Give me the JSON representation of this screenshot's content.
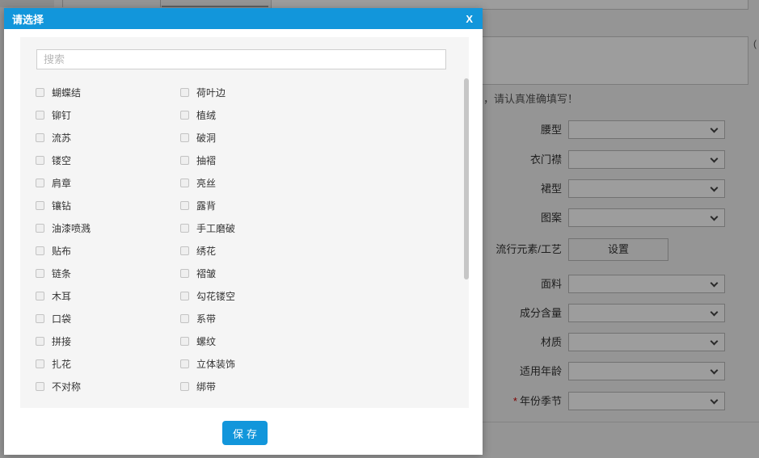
{
  "modal": {
    "title": "请选择",
    "close_label": "X",
    "search": {
      "placeholder": "搜索",
      "value": ""
    },
    "options": [
      {
        "label": "蝴蝶结",
        "checked": false
      },
      {
        "label": "荷叶边",
        "checked": false
      },
      {
        "label": "铆钉",
        "checked": false
      },
      {
        "label": "植绒",
        "checked": false
      },
      {
        "label": "流苏",
        "checked": false
      },
      {
        "label": "破洞",
        "checked": false
      },
      {
        "label": "镂空",
        "checked": false
      },
      {
        "label": "抽褶",
        "checked": false
      },
      {
        "label": "肩章",
        "checked": false
      },
      {
        "label": "亮丝",
        "checked": false
      },
      {
        "label": "镶钻",
        "checked": false
      },
      {
        "label": "露背",
        "checked": false
      },
      {
        "label": "油漆喷溅",
        "checked": false
      },
      {
        "label": "手工磨破",
        "checked": false
      },
      {
        "label": "贴布",
        "checked": false
      },
      {
        "label": "绣花",
        "checked": false
      },
      {
        "label": "链条",
        "checked": false
      },
      {
        "label": "褶皱",
        "checked": false
      },
      {
        "label": "木耳",
        "checked": false
      },
      {
        "label": "勾花镂空",
        "checked": false
      },
      {
        "label": "口袋",
        "checked": false
      },
      {
        "label": "系带",
        "checked": false
      },
      {
        "label": "拼接",
        "checked": false
      },
      {
        "label": "螺纹",
        "checked": false
      },
      {
        "label": "扎花",
        "checked": false
      },
      {
        "label": "立体装饰",
        "checked": false
      },
      {
        "label": "不对称",
        "checked": false
      },
      {
        "label": "绑带",
        "checked": false
      }
    ],
    "save_label": "保存"
  },
  "background_form": {
    "top_input_value": "",
    "textarea_value": "",
    "counter_fragment": "(",
    "hint_text": "，请认真准确填写！",
    "fields": [
      {
        "label": "腰型",
        "control": "select",
        "value": "",
        "required": false
      },
      {
        "label": "衣门襟",
        "control": "select",
        "value": "",
        "required": false
      },
      {
        "label": "裙型",
        "control": "select",
        "value": "",
        "required": false
      },
      {
        "label": "图案",
        "control": "select",
        "value": "",
        "required": false
      },
      {
        "label": "流行元素/工艺",
        "control": "button",
        "button_label": "设置",
        "required": false
      },
      {
        "label": "面料",
        "control": "select",
        "value": "",
        "required": false
      },
      {
        "label": "成分含量",
        "control": "select",
        "value": "",
        "required": false
      },
      {
        "label": "材质",
        "control": "select",
        "value": "",
        "required": false
      },
      {
        "label": "适用年龄",
        "control": "select",
        "value": "",
        "required": false
      },
      {
        "label": "年份季节",
        "control": "select",
        "value": "",
        "required": true
      }
    ]
  },
  "colors": {
    "accent": "#1296db",
    "required": "#cc0000"
  }
}
